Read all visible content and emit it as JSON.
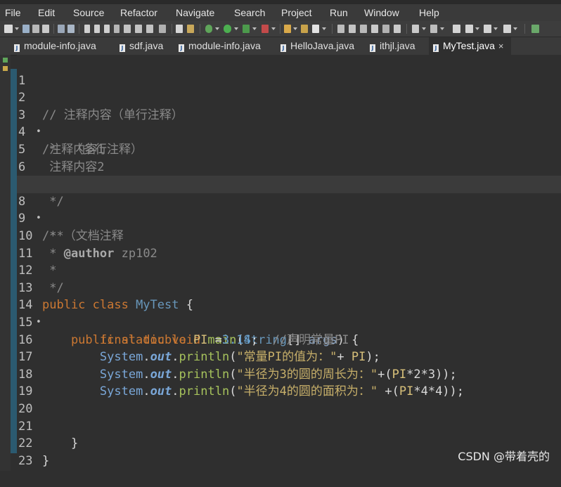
{
  "menubar": {
    "items": [
      "File",
      "Edit",
      "Source",
      "Refactor",
      "Navigate",
      "Search",
      "Project",
      "Run",
      "Window",
      "Help"
    ]
  },
  "tabs": [
    {
      "label": "module-info.java",
      "active": false
    },
    {
      "label": "sdf.java",
      "active": false
    },
    {
      "label": "module-info.java",
      "active": false
    },
    {
      "label": "HelloJava.java",
      "active": false
    },
    {
      "label": "ithjl.java",
      "active": false
    },
    {
      "label": "MyTest.java",
      "active": true
    }
  ],
  "tab_close_glyph": "×",
  "editor": {
    "line_numbers": [
      "1",
      "2",
      "3",
      "4",
      "5",
      "6",
      "7",
      "8",
      "9",
      "10",
      "11",
      "12",
      "13",
      "14",
      "15",
      "16",
      "17",
      "18",
      "19",
      "20",
      "21",
      "22",
      "23"
    ],
    "fold_marker": "•",
    "code": {
      "l2": "// 注释内容（单行注释）",
      "l3_a": "/*",
      "l3_b": "  （多行注释）",
      "l4": " 注释内容1",
      "l5": " 注释内容2",
      "l6": " ...",
      "l7": " */",
      "l8": "/**",
      "l9": " * （文档注释",
      "l10_a": " * ",
      "l10_b": "@author",
      "l10_c": " zp102",
      "l11": " *",
      "l12": " */",
      "l13_a": "public class ",
      "l13_b": "MyTest",
      "l13_c": " {",
      "l14_a": "    public static void ",
      "l14_b": "main",
      "l14_c": "(",
      "l14_d": "String",
      "l14_e": "[] ",
      "l14_f": "args",
      "l14_g": ") {",
      "l15_a": "        final double ",
      "l15_b": "PI",
      "l15_c": " =",
      "l15_d": "3.14",
      "l15_e": ";  ",
      "l15_f": "//声明常量PI",
      "sys": "System",
      "dot": ".",
      "out": "out",
      "println": "println",
      "l16_str": "\"常量PI的值为：\"",
      "l16_rest_a": "+ ",
      "l16_rest_b": "PI",
      "l16_rest_c": ");",
      "l17_str": "\"半径为3的圆的周长为：\"",
      "l17_rest_a": "+(",
      "l17_rest_b": "PI",
      "l17_rest_c": "*2*3));",
      "l18_str": "\"半径为4的圆的面积为：\"",
      "l18_rest_a": " +(",
      "l18_rest_b": "PI",
      "l18_rest_c": "*4*4));",
      "l21": "    }",
      "l22": "}"
    }
  },
  "watermark": "CSDN @带着壳的",
  "colors": {
    "background": "#2f2f2f",
    "keyword": "#cc7832",
    "comment": "#8a8a8a",
    "class_name": "#6897bb",
    "method": "#a6c25c",
    "string": "#c8b06a",
    "number": "#6aa4d4",
    "field": "#7aa7d8",
    "blue_strip": "#2b5a70"
  }
}
